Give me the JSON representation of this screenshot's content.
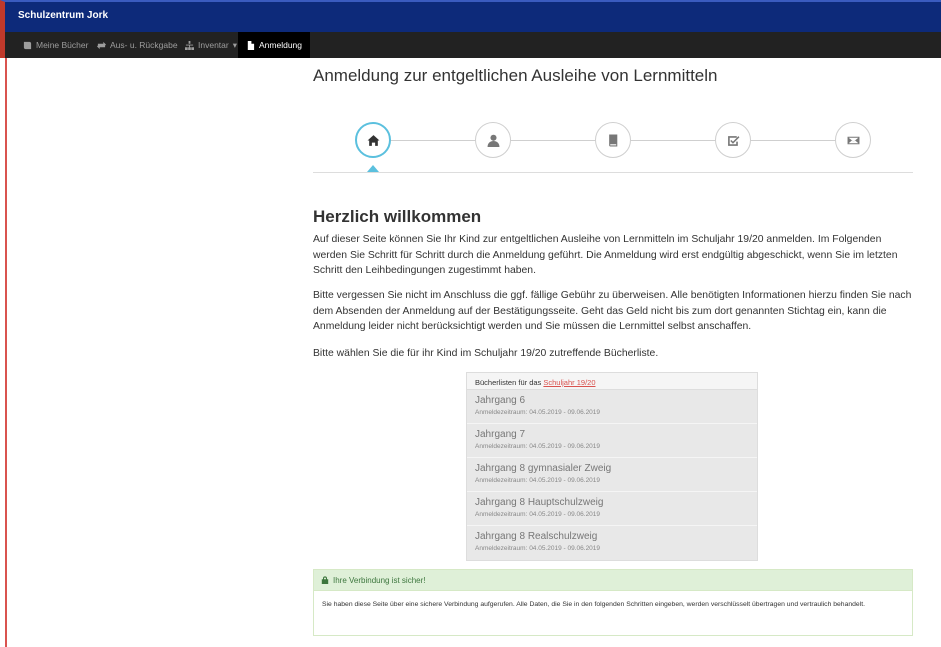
{
  "app": {
    "brand": "Schulzentrum Jork"
  },
  "nav": {
    "items": [
      {
        "label": "Meine Bücher",
        "icon": "book-icon"
      },
      {
        "label": "Aus- u. Rückgabe",
        "icon": "transfer-icon"
      },
      {
        "label": "Inventar",
        "icon": "sitemap-icon",
        "dropdown": true,
        "caret": "▾"
      },
      {
        "label": "Anmeldung",
        "icon": "file-icon",
        "active": true
      }
    ]
  },
  "page": {
    "title": "Anmeldung zur entgeltlichen Ausleihe von Lernmitteln"
  },
  "wizard": {
    "steps": [
      {
        "icon": "home-icon",
        "active": true
      },
      {
        "icon": "user-icon",
        "active": false
      },
      {
        "icon": "book-icon",
        "active": false
      },
      {
        "icon": "check-icon",
        "active": false
      },
      {
        "icon": "envelope-icon",
        "active": false
      }
    ],
    "accent": "#5bc0de"
  },
  "welcome": {
    "heading": "Herzlich willkommen",
    "p1": "Auf dieser Seite können Sie Ihr Kind zur entgeltlichen Ausleihe von Lernmitteln im Schuljahr 19/20 anmelden. Im Folgenden werden Sie Schritt für Schritt durch die Anmeldung geführt. Die Anmeldung wird erst endgültig abgeschickt, wenn Sie im letzten Schritt den Leihbedingungen zugestimmt haben.",
    "p2": "Bitte vergessen Sie nicht im Anschluss die ggf. fällige Gebühr zu überweisen. Alle benötigten Informationen hierzu finden Sie nach dem Absenden der Anmeldung auf der Bestätigungsseite. Geht das Geld nicht bis zum dort genannten Stichtag ein, kann die Anmeldung leider nicht berücksichtigt werden und Sie müssen die Lernmittel selbst anschaffen.",
    "p3": "Bitte wählen Sie die für ihr Kind im Schuljahr 19/20 zutreffende Bücherliste."
  },
  "booklists": {
    "header_prefix": "Bücherlisten für das ",
    "header_link": "Schuljahr 19/20",
    "items": [
      {
        "name": "Jahrgang 6",
        "range": "Anmeldezeitraum: 04.05.2019 - 09.06.2019"
      },
      {
        "name": "Jahrgang 7",
        "range": "Anmeldezeitraum: 04.05.2019 - 09.06.2019"
      },
      {
        "name": "Jahrgang 8 gymnasialer Zweig",
        "range": "Anmeldezeitraum: 04.05.2019 - 09.06.2019"
      },
      {
        "name": "Jahrgang 8 Hauptschulzweig",
        "range": "Anmeldezeitraum: 04.05.2019 - 09.06.2019"
      },
      {
        "name": "Jahrgang 8 Realschulzweig",
        "range": "Anmeldezeitraum: 04.05.2019 - 09.06.2019"
      }
    ]
  },
  "secure": {
    "icon": "lock-icon",
    "heading": "Ihre Verbindung ist sicher!",
    "body": "Sie haben diese Seite über eine sichere Verbindung aufgerufen. Alle Daten, die Sie in den folgenden Schritten eingeben, werden verschlüsselt übertragen und vertraulich behandelt."
  },
  "colors": {
    "topbar": "#0d2a7a",
    "navbar": "#222222",
    "link": "#d9534f",
    "success_bg": "#dff0d8",
    "success_text": "#3c763d"
  }
}
